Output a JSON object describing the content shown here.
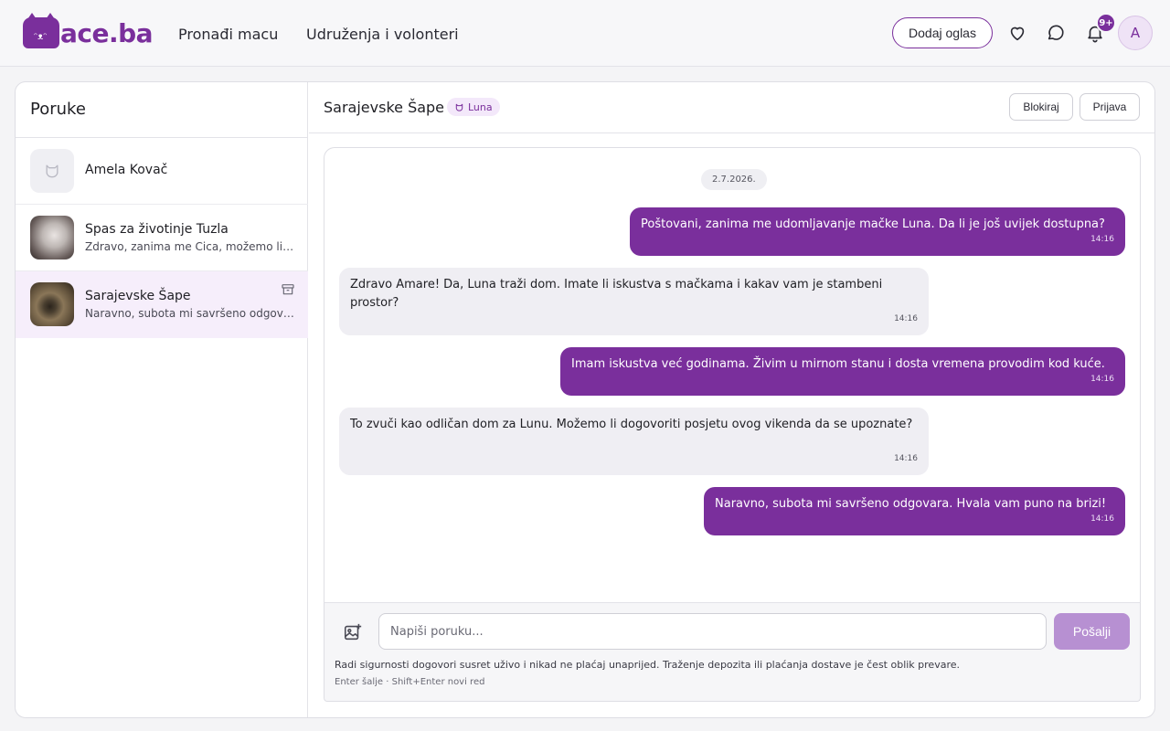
{
  "brand": {
    "name": "Mace.ba",
    "logo_text": "ace.ba",
    "logo_letter": "M"
  },
  "nav": {
    "find_cat": "Pronađi macu",
    "associations": "Udruženja i volonteri"
  },
  "header": {
    "add_listing": "Dodaj oglas",
    "notification_count": "9+",
    "avatar_initial": "A"
  },
  "sidebar": {
    "title": "Poruke",
    "conversations": [
      {
        "name": "Amela Kovač",
        "preview": "",
        "avatar": "cat-placeholder-icon"
      },
      {
        "name": "Spas za životinje Tuzla",
        "preview": "Zdravo, zanima me Cica, možemo li p...",
        "avatar": "photo"
      },
      {
        "name": "Sarajevske Šape",
        "preview": "Naravno, subota mi savršeno odgovar...",
        "avatar": "photo",
        "active": true
      }
    ]
  },
  "chat": {
    "title": "Sarajevske Šape",
    "pet_tag": "Luna",
    "block_label": "Blokiraj",
    "report_label": "Prijava",
    "date": "2.7.2026.",
    "messages": [
      {
        "dir": "out",
        "text": "Poštovani, zanima me udomljavanje mačke Luna. Da li je još uvijek dostupna?",
        "time": "14:16"
      },
      {
        "dir": "in",
        "text": "Zdravo Amare! Da, Luna traži dom. Imate li iskustva s mačkama i kakav vam je stambeni prostor?",
        "time": "14:16"
      },
      {
        "dir": "out",
        "text": "Imam iskustva već godinama. Živim u mirnom stanu i dosta vremena provodim kod kuće.",
        "time": "14:16"
      },
      {
        "dir": "in",
        "text": "To zvuči kao odličan dom za Lunu. Možemo li dogovoriti posjetu ovog vikenda da se upoznate?",
        "time": "14:16"
      },
      {
        "dir": "out",
        "text": "Naravno, subota mi savršeno odgovara. Hvala vam puno na brizi!",
        "time": "14:16"
      }
    ]
  },
  "composer": {
    "placeholder": "Napiši poruku...",
    "send_label": "Pošalji",
    "notice": "Radi sigurnosti dogovori susret uživo i nikad ne plaćaj unaprijed. Traženje depozita ili plaćanja dostave je čest oblik prevare.",
    "hint": "Enter šalje · Shift+Enter novi red"
  },
  "colors": {
    "accent": "#7a2f9c",
    "accent_light": "#b790d2",
    "incoming_bubble": "#efeef3"
  }
}
